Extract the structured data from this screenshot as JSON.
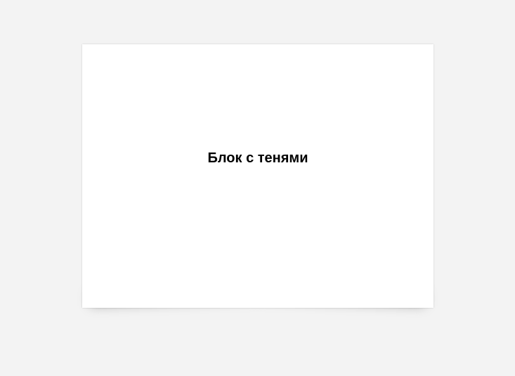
{
  "card": {
    "title": "Блок с тенями"
  },
  "colors": {
    "page_background": "#f3f3f3",
    "card_background": "#ffffff",
    "title_color": "#000000"
  }
}
